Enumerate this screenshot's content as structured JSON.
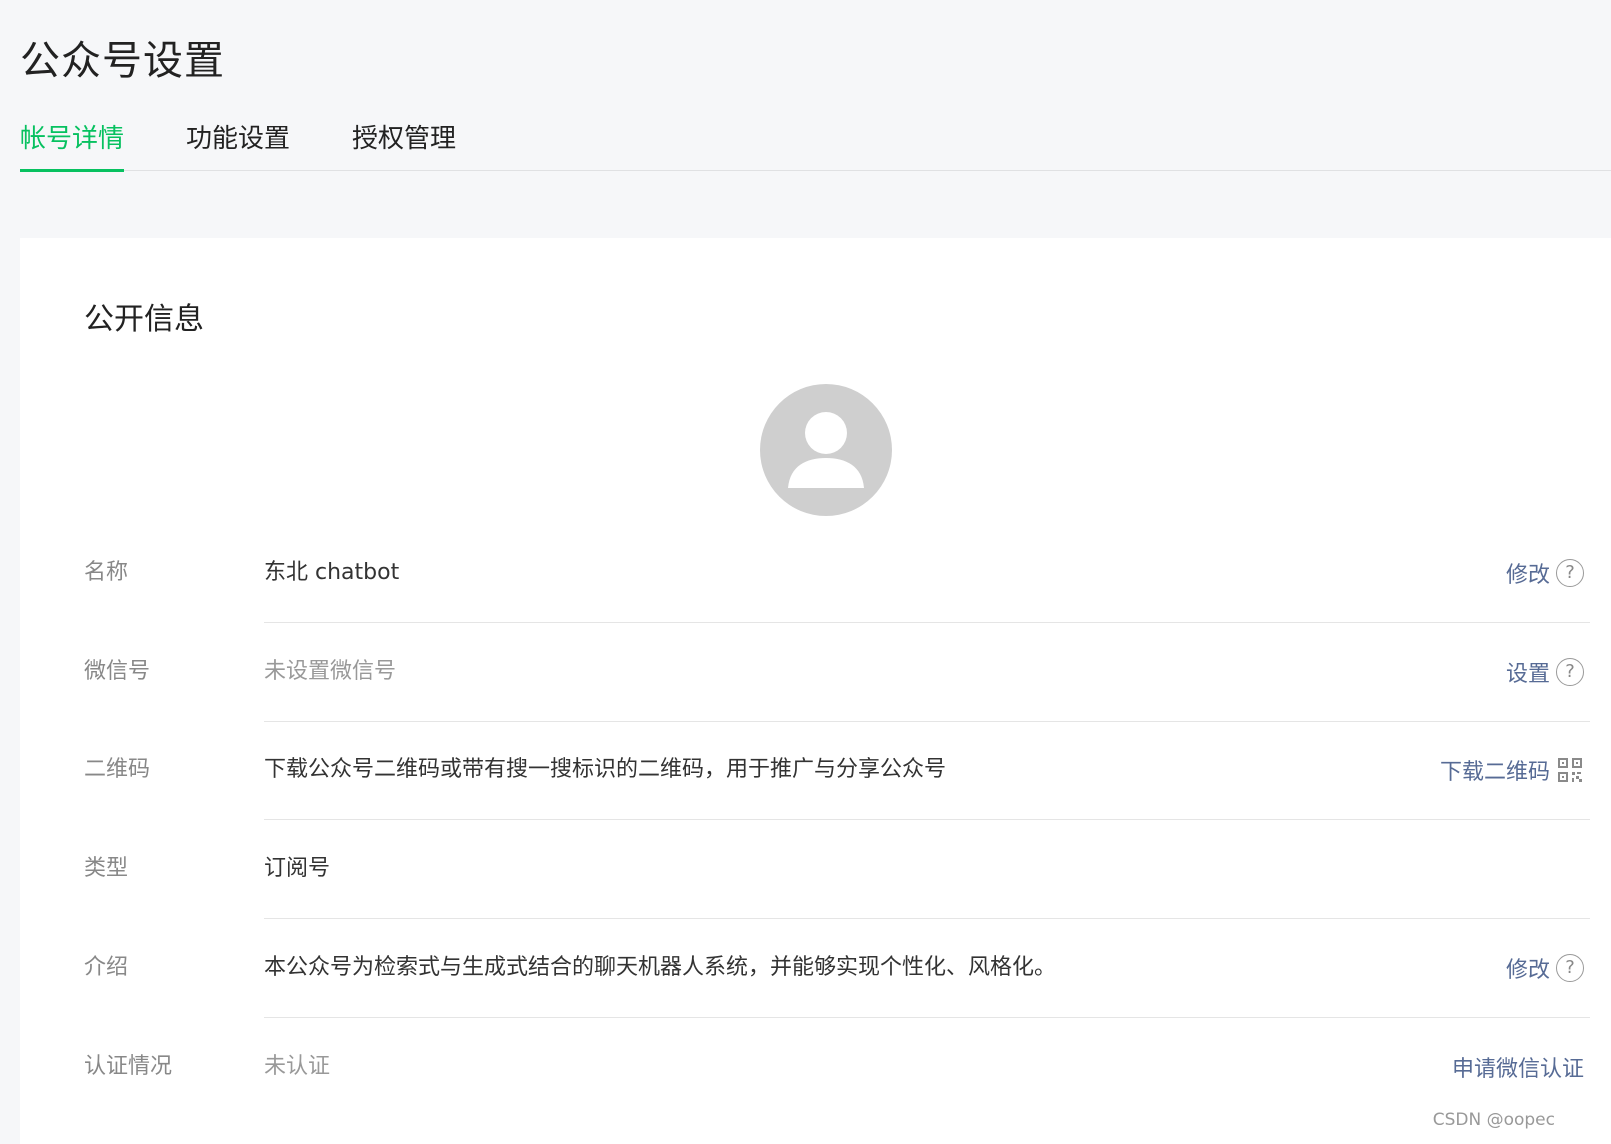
{
  "header": {
    "title": "公众号设置",
    "tabs": [
      {
        "label": "帐号详情",
        "active": true
      },
      {
        "label": "功能设置",
        "active": false
      },
      {
        "label": "授权管理",
        "active": false
      }
    ]
  },
  "card": {
    "section_title": "公开信息",
    "avatar_icon": "user-placeholder-icon",
    "rows": [
      {
        "label": "名称",
        "value": "东北 chatbot",
        "action": "修改"
      },
      {
        "label": "微信号",
        "value": "未设置微信号",
        "action": "设置"
      },
      {
        "label": "二维码",
        "value": "下载公众号二维码或带有搜一搜标识的二维码，用于推广与分享公众号",
        "action": "下载二维码"
      },
      {
        "label": "类型",
        "value": "订阅号",
        "action": ""
      },
      {
        "label": "介绍",
        "value": "本公众号为检索式与生成式结合的聊天机器人系统，并能够实现个性化、风格化。",
        "action": "修改"
      },
      {
        "label": "认证情况",
        "value": "未认证",
        "action": "申请微信认证"
      }
    ]
  },
  "help_icon_glyph": "?",
  "watermark": "CSDN @oopec",
  "colors": {
    "accent": "#07c160",
    "link": "#576b95",
    "background": "#f6f7f9"
  }
}
